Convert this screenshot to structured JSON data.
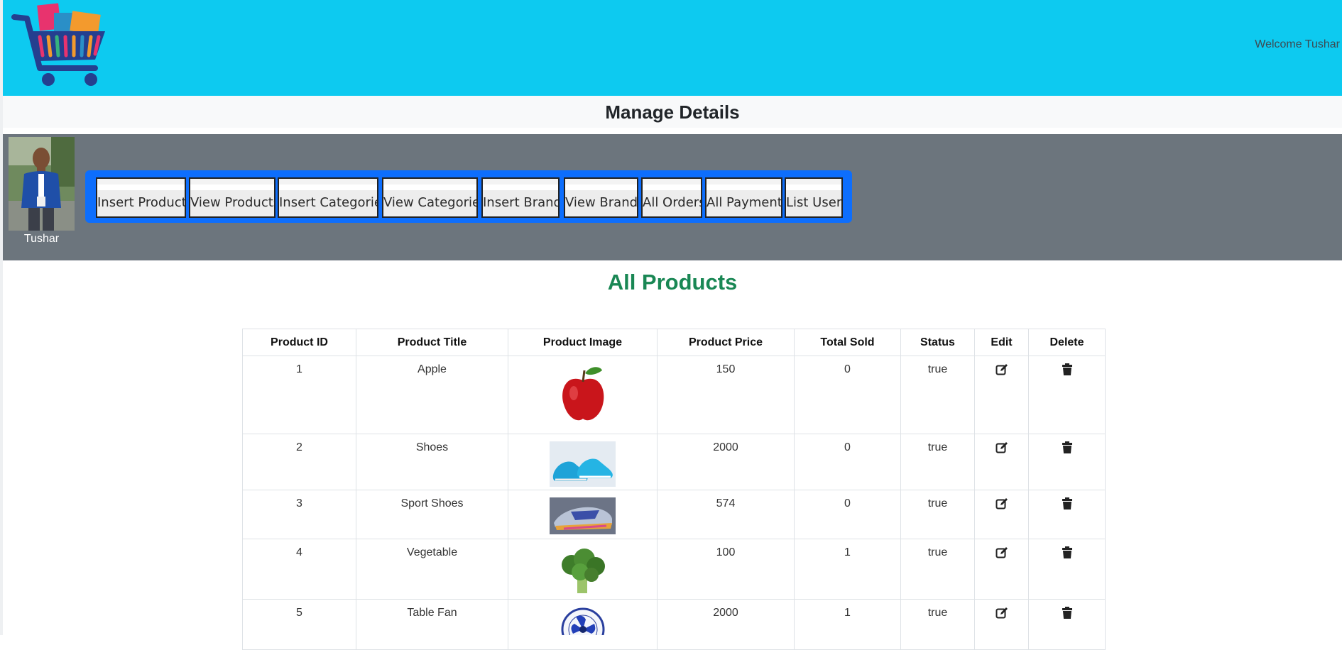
{
  "header": {
    "welcome_text": "Welcome Tushar",
    "background": "#0dcaf0"
  },
  "manage": {
    "title": "Manage Details"
  },
  "admin": {
    "name": "Tushar",
    "buttons": [
      "Insert Products",
      "View Products",
      "Insert Categories",
      "View Categories",
      "Insert Brands",
      "View Brands",
      "All Orders",
      "All Payments",
      "List Users"
    ]
  },
  "products": {
    "title": "All Products",
    "title_color": "#198754",
    "columns": [
      "Product ID",
      "Product Title",
      "Product Image",
      "Product Price",
      "Total Sold",
      "Status",
      "Edit",
      "Delete"
    ],
    "rows": [
      {
        "id": "1",
        "title": "Apple",
        "image": "apple-image",
        "price": "150",
        "sold": "0",
        "status": "true"
      },
      {
        "id": "2",
        "title": "Shoes",
        "image": "shoes-image",
        "price": "2000",
        "sold": "0",
        "status": "true"
      },
      {
        "id": "3",
        "title": "Sport Shoes",
        "image": "sport-shoes-image",
        "price": "574",
        "sold": "0",
        "status": "true"
      },
      {
        "id": "4",
        "title": "Vegetable",
        "image": "broccoli-image",
        "price": "100",
        "sold": "1",
        "status": "true"
      },
      {
        "id": "5",
        "title": "Table Fan",
        "image": "table-fan-image",
        "price": "2000",
        "sold": "1",
        "status": "true"
      }
    ]
  },
  "icons": {
    "edit": "edit-icon",
    "delete": "trash-icon"
  }
}
